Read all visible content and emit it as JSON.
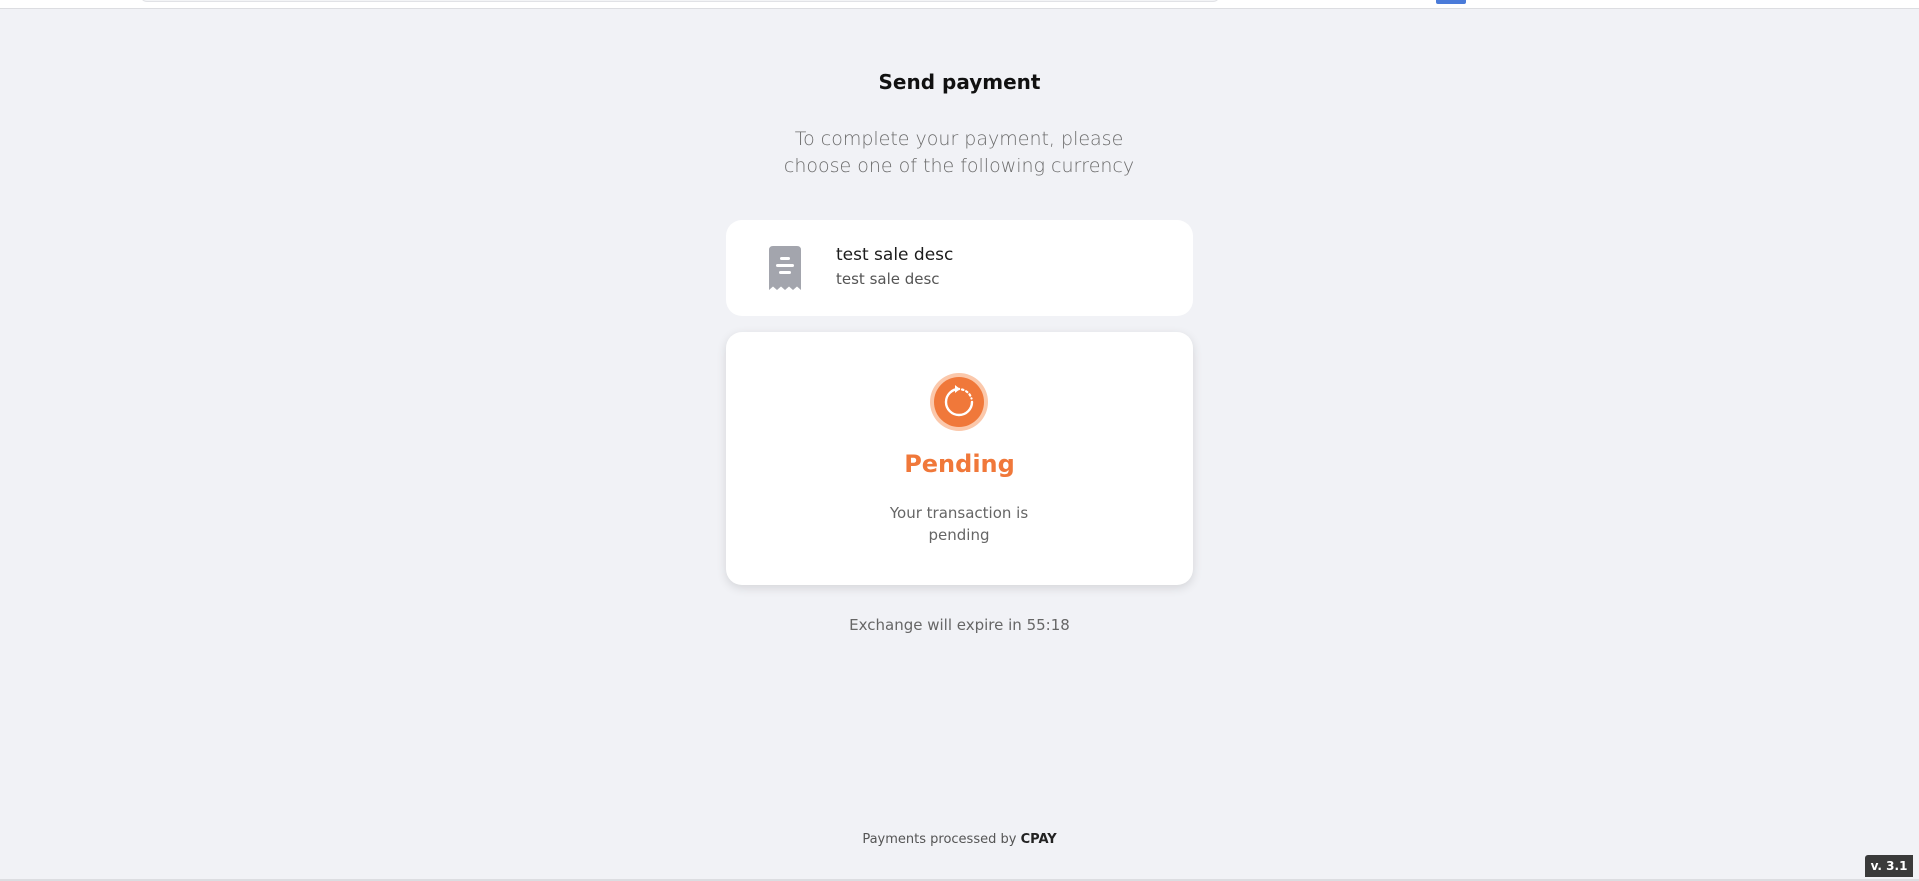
{
  "page": {
    "title": "Send payment",
    "subtitle": "To complete your payment, please choose one of the following currency"
  },
  "sale": {
    "title": "test sale desc",
    "description": "test sale desc",
    "icon": "receipt-icon"
  },
  "status": {
    "icon": "pending-refresh-icon",
    "title": "Pending",
    "message": "Your transaction is pending",
    "color": "#f0783a"
  },
  "timer": {
    "text": "Exchange will expire in 55:18"
  },
  "footer": {
    "prefix": "Payments processed by",
    "brand": "CPAY"
  },
  "version": "v. 3.1"
}
